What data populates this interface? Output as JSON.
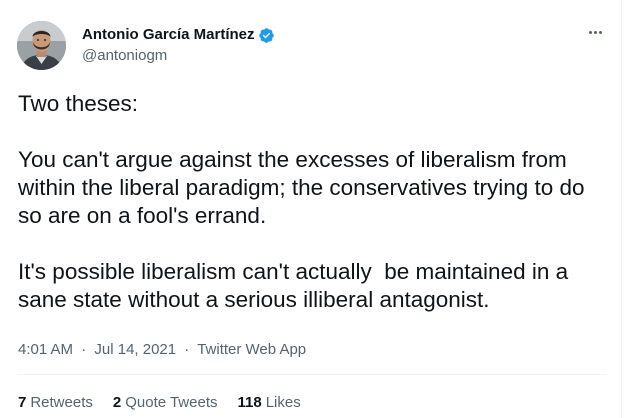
{
  "author": {
    "display_name": "Antonio García Martínez",
    "handle": "@antoniogm",
    "verified": true
  },
  "tweet": {
    "text": "Two theses:\n\nYou can't argue against the excesses of liberalism from within the liberal paradigm; the conservatives trying to do so are on a fool's errand.\n\nIt's possible liberalism can't actually  be maintained in a sane state without a serious illiberal antagonist.",
    "time": "4:01 AM",
    "date": "Jul 14, 2021",
    "source": "Twitter Web App",
    "separator": "·"
  },
  "stats": {
    "retweets_count": "7",
    "retweets_label": "Retweets",
    "quotes_count": "2",
    "quotes_label": "Quote Tweets",
    "likes_count": "118",
    "likes_label": "Likes"
  },
  "icons": {
    "verified": "verified-badge-icon",
    "more": "more-options-icon"
  },
  "colors": {
    "verified_blue": "#1d9bf0",
    "text_primary": "#0f1419",
    "text_secondary": "#536471",
    "divider": "#eff3f4"
  }
}
